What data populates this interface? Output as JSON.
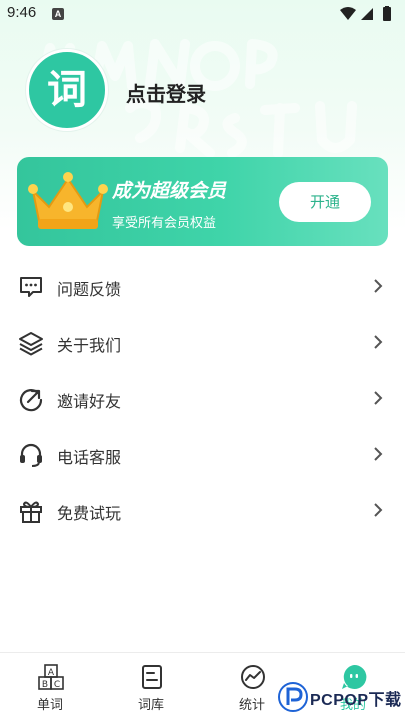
{
  "status_bar": {
    "time": "9:46",
    "app_badge": "A"
  },
  "profile": {
    "avatar_glyph": "词",
    "login_text": "点击登录"
  },
  "vip": {
    "title": "成为超级会员",
    "subtitle": "享受所有会员权益",
    "button_label": "开通"
  },
  "menu": {
    "items": [
      {
        "label": "问题反馈",
        "icon": "feedback-icon"
      },
      {
        "label": "关于我们",
        "icon": "layers-icon"
      },
      {
        "label": "邀请好友",
        "icon": "share-arrow-icon"
      },
      {
        "label": "电话客服",
        "icon": "headset-icon"
      },
      {
        "label": "免费试玩",
        "icon": "gift-icon"
      }
    ]
  },
  "bottom_nav": {
    "items": [
      {
        "label": "单词",
        "icon": "abc-blocks-icon"
      },
      {
        "label": "词库",
        "icon": "book-icon"
      },
      {
        "label": "统计",
        "icon": "stats-icon"
      },
      {
        "label": "我的",
        "icon": "profile-face-icon",
        "active": true
      }
    ]
  },
  "watermark": {
    "text": "PCPOP下载"
  },
  "colors": {
    "accent": "#2ec7a2",
    "vip_start": "#34c59c",
    "vip_end": "#68e0be",
    "crown": "#f7b52c"
  }
}
